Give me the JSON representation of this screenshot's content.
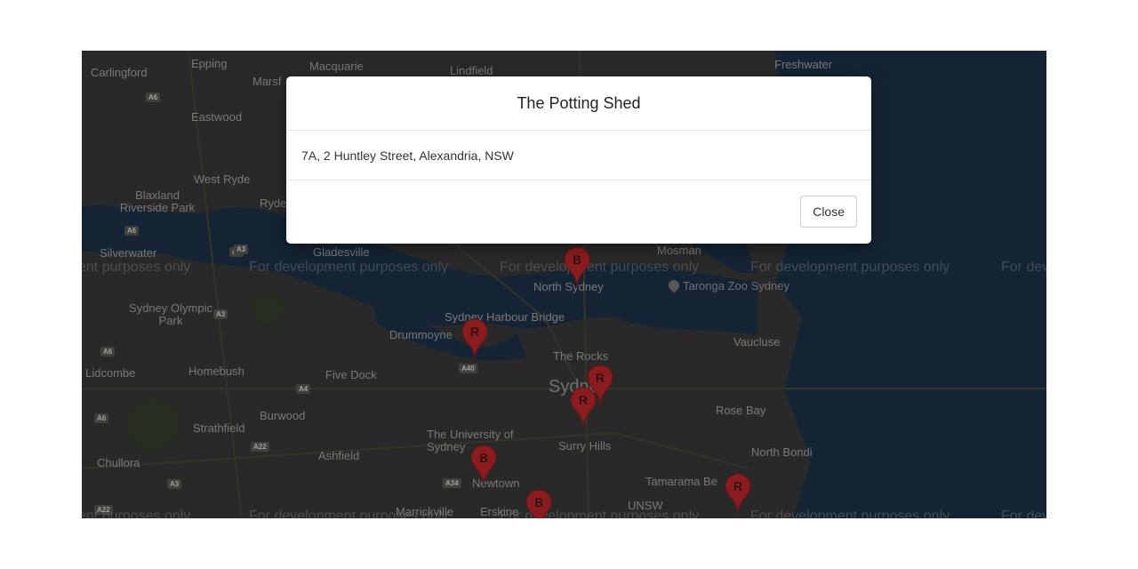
{
  "modal": {
    "title": "The Potting Shed",
    "address": "7A, 2 Huntley Street, Alexandria, NSW",
    "close_label": "Close"
  },
  "map": {
    "watermark": "For development purposes only",
    "watermark_partial_left": "ent purposes only",
    "watermark_partial_right": "For dev",
    "suburbs": [
      "Carlingford",
      "Epping",
      "Macquarie",
      "Lindfield",
      "Freshwater",
      "Marsf",
      "Eastwood",
      "West Ryde",
      "Ryde",
      "Blaxland Riverside Park",
      "Silverwater",
      "Gladesville",
      "Mosman",
      "North Sydney",
      "Sydney Olympic Park",
      "Drummoyne",
      "Sydney Harbour Bridge",
      "Vaucluse",
      "Lidcombe",
      "Homebush",
      "Five Dock",
      "The Rocks",
      "Sydney",
      "Burwood",
      "Rose Bay",
      "Strathfield",
      "The University of Sydney",
      "Surry Hills",
      "Chullora",
      "Ashfield",
      "Newtown",
      "North Bondi",
      "Tamarama Be",
      "Marrickville",
      "Erskine",
      "UNSW",
      "Taronga Zoo Sydney"
    ],
    "road_shields": [
      "A6",
      "A6",
      "A3",
      "A3",
      "A6",
      "A4",
      "A6",
      "A40",
      "A22",
      "A34",
      "A3",
      "A22",
      "A3"
    ],
    "markers": [
      "B",
      "R",
      "R",
      "R",
      "B",
      "B",
      "R"
    ]
  },
  "colors": {
    "water": "#1c3349",
    "land": "#3b3b3b",
    "marker": "#c0272d"
  }
}
